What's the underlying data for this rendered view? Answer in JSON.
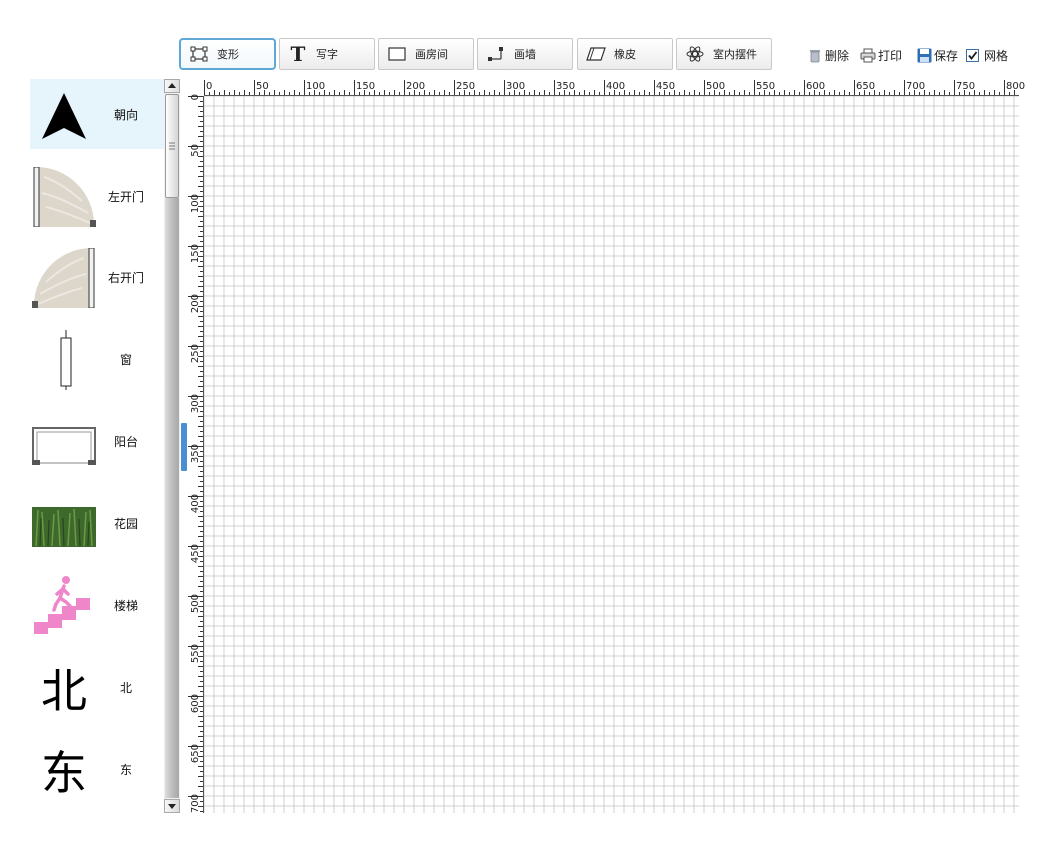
{
  "toolbar": {
    "tools": [
      {
        "label": "变形",
        "icon": "transform-icon",
        "active": true
      },
      {
        "label": "写字",
        "icon": "text-icon",
        "active": false
      },
      {
        "label": "画房间",
        "icon": "room-rect-icon",
        "active": false
      },
      {
        "label": "画墙",
        "icon": "wall-icon",
        "active": false
      },
      {
        "label": "橡皮",
        "icon": "eraser-icon",
        "active": false
      },
      {
        "label": "室内摆件",
        "icon": "furniture-icon",
        "active": false
      }
    ],
    "actions": {
      "delete_label": "删除",
      "print_label": "打印",
      "save_label": "保存",
      "grid_label": "网格",
      "grid_checked": true
    }
  },
  "palette": {
    "items": [
      {
        "label": "朝向",
        "icon": "north-arrow-icon",
        "selected": true
      },
      {
        "label": "左开门",
        "icon": "left-door-icon"
      },
      {
        "label": "右开门",
        "icon": "right-door-icon"
      },
      {
        "label": "窗",
        "icon": "window-icon"
      },
      {
        "label": "阳台",
        "icon": "balcony-icon"
      },
      {
        "label": "花园",
        "icon": "garden-icon"
      },
      {
        "label": "楼梯",
        "icon": "stairs-icon"
      },
      {
        "label": "北",
        "icon": "north-char-icon",
        "glyph": "北"
      },
      {
        "label": "东",
        "icon": "east-char-icon",
        "glyph": "东"
      }
    ]
  },
  "canvas": {
    "h_ruler_labels": [
      "0",
      "50",
      "100",
      "150",
      "200",
      "250",
      "300",
      "350",
      "400",
      "450",
      "500",
      "550",
      "600",
      "650",
      "700",
      "750",
      "800"
    ],
    "v_ruler_labels": [
      "0",
      "50",
      "100",
      "150",
      "200",
      "250",
      "300",
      "350",
      "400",
      "450",
      "500",
      "550",
      "600",
      "650",
      "700"
    ],
    "grid_visible": true,
    "colors": {
      "grid_line": "#c4c4c4",
      "accent": "#5fa8d6",
      "side_tab": "#4c8fd0",
      "stairs": "#ee86c9",
      "palette_selected_bg": "#e6f4fb"
    }
  }
}
